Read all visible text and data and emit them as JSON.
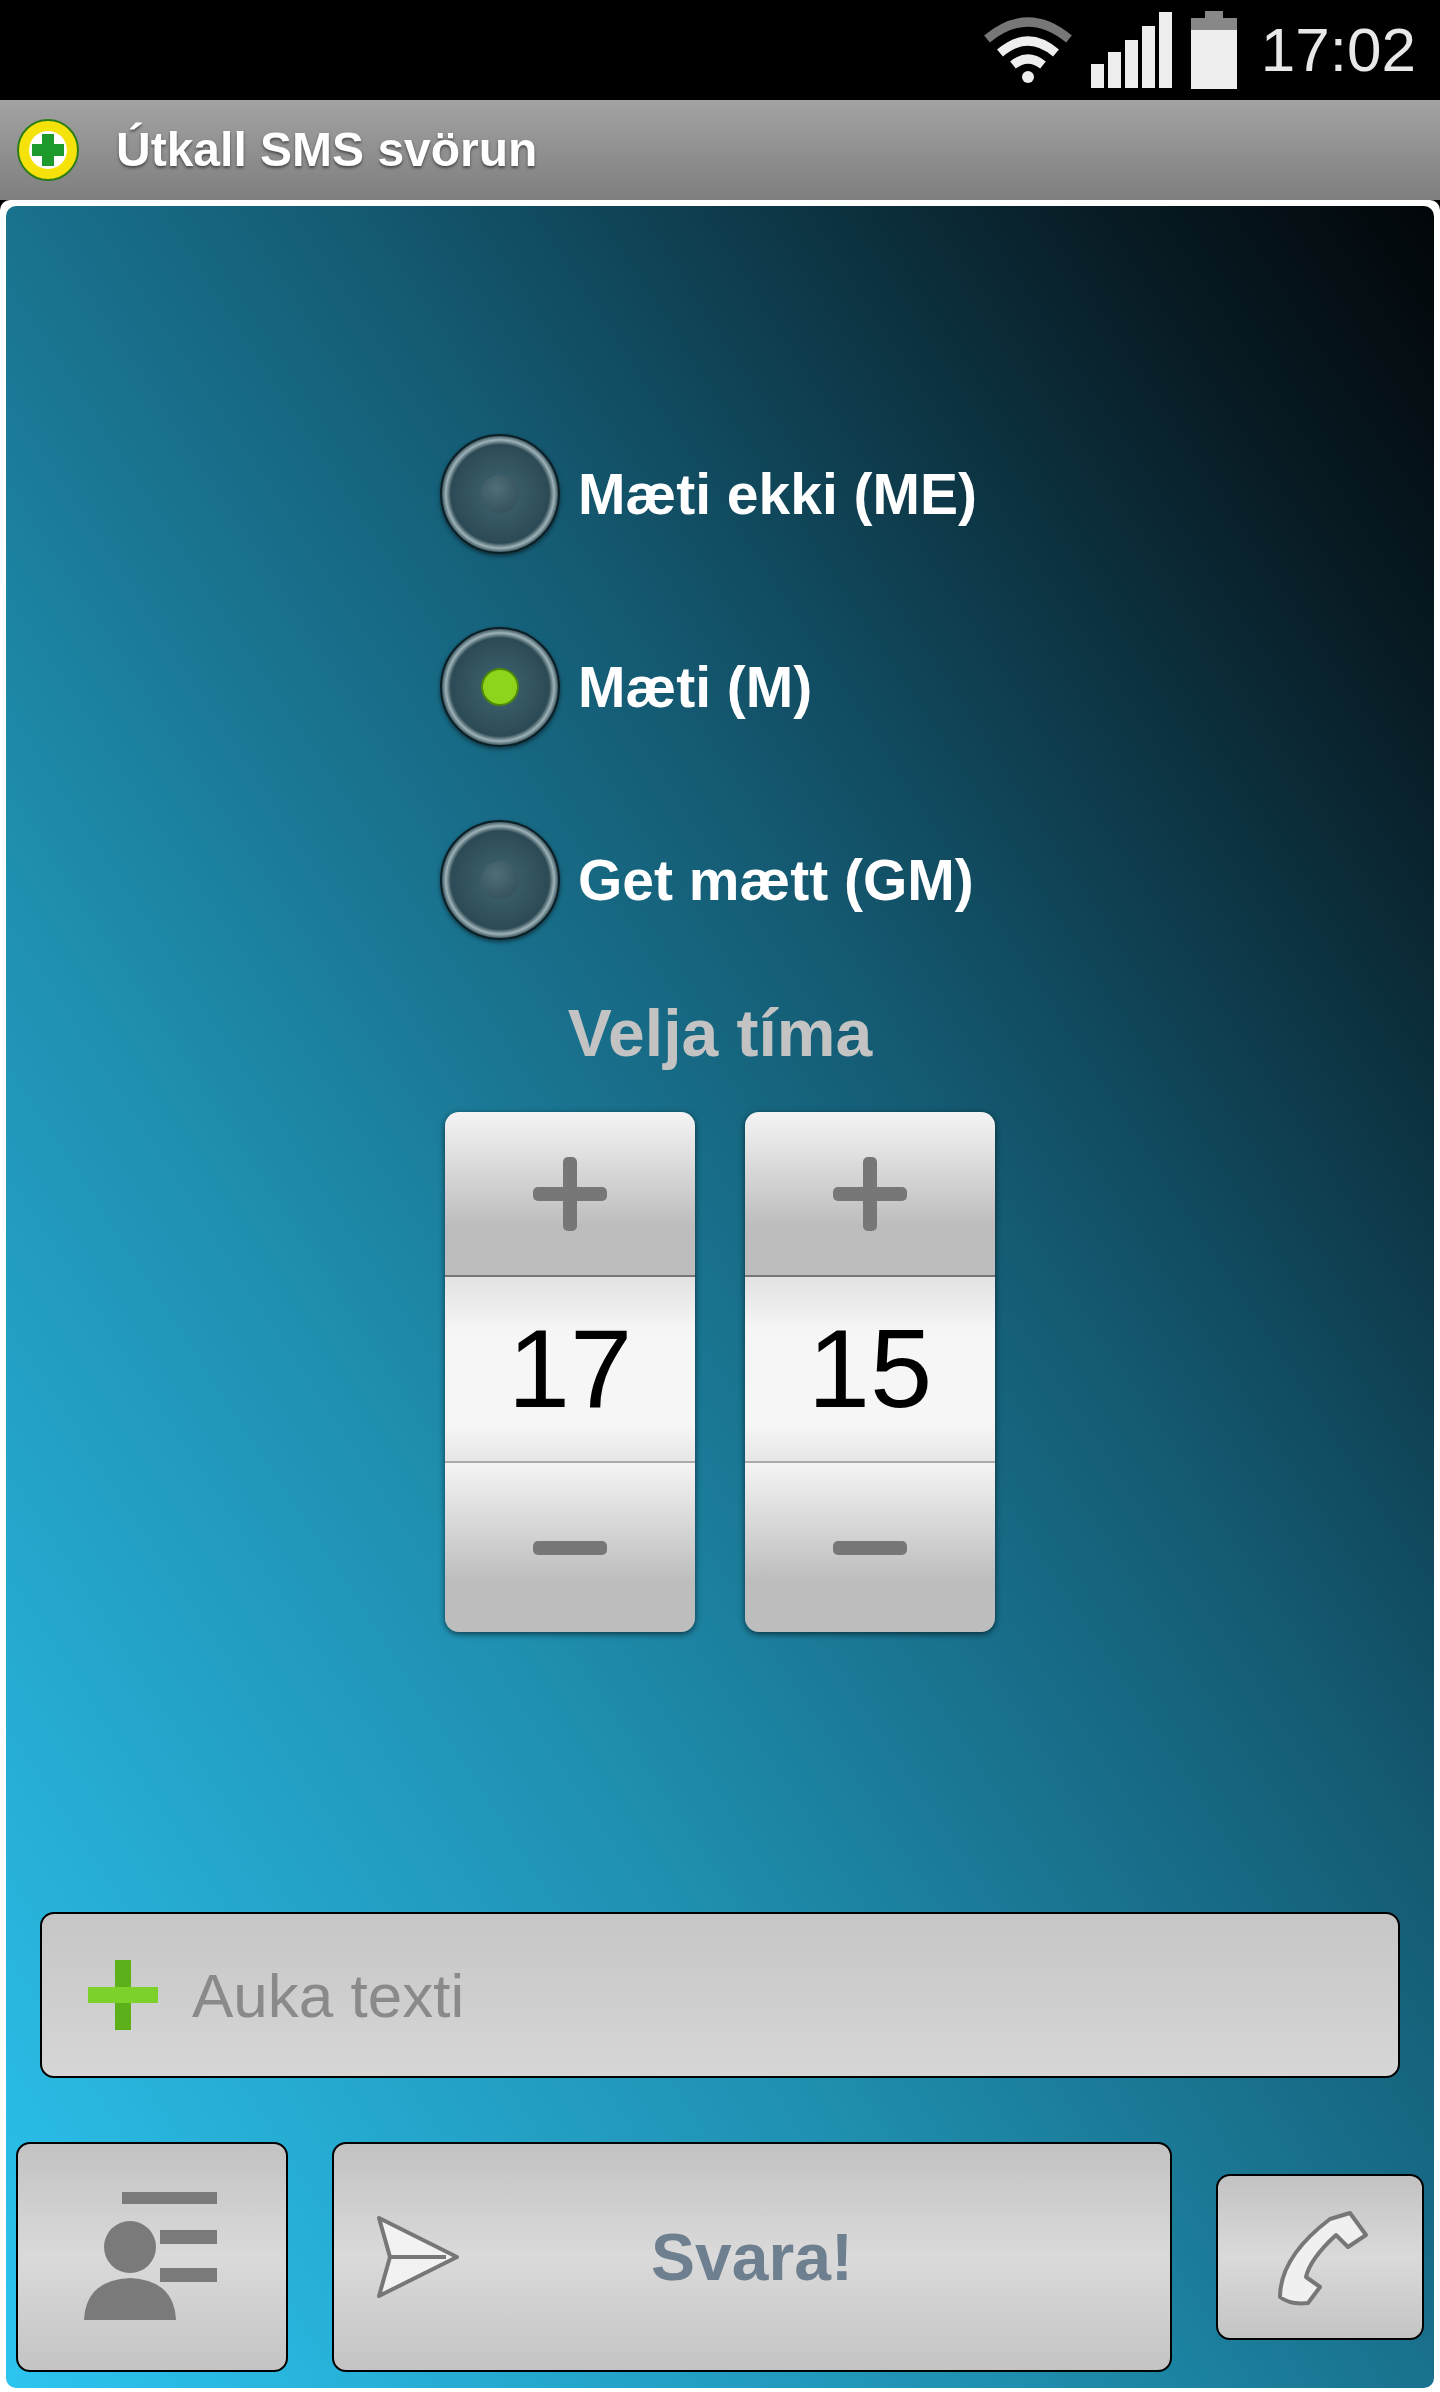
{
  "status_bar": {
    "time": "17:02"
  },
  "app_bar": {
    "title": "Útkall SMS svörun"
  },
  "radios": [
    {
      "label": "Mæti ekki (ME)",
      "selected": false
    },
    {
      "label": "Mæti (M)",
      "selected": true
    },
    {
      "label": "Get mætt (GM)",
      "selected": false
    }
  ],
  "time_picker": {
    "title": "Velja tíma",
    "fields": [
      {
        "value": "17"
      },
      {
        "value": "15"
      }
    ]
  },
  "text_field": {
    "placeholder": "Auka texti"
  },
  "buttons": [
    {
      "kind": "contacts"
    },
    {
      "kind": "send",
      "label": "Svara!"
    },
    {
      "kind": "call"
    }
  ]
}
